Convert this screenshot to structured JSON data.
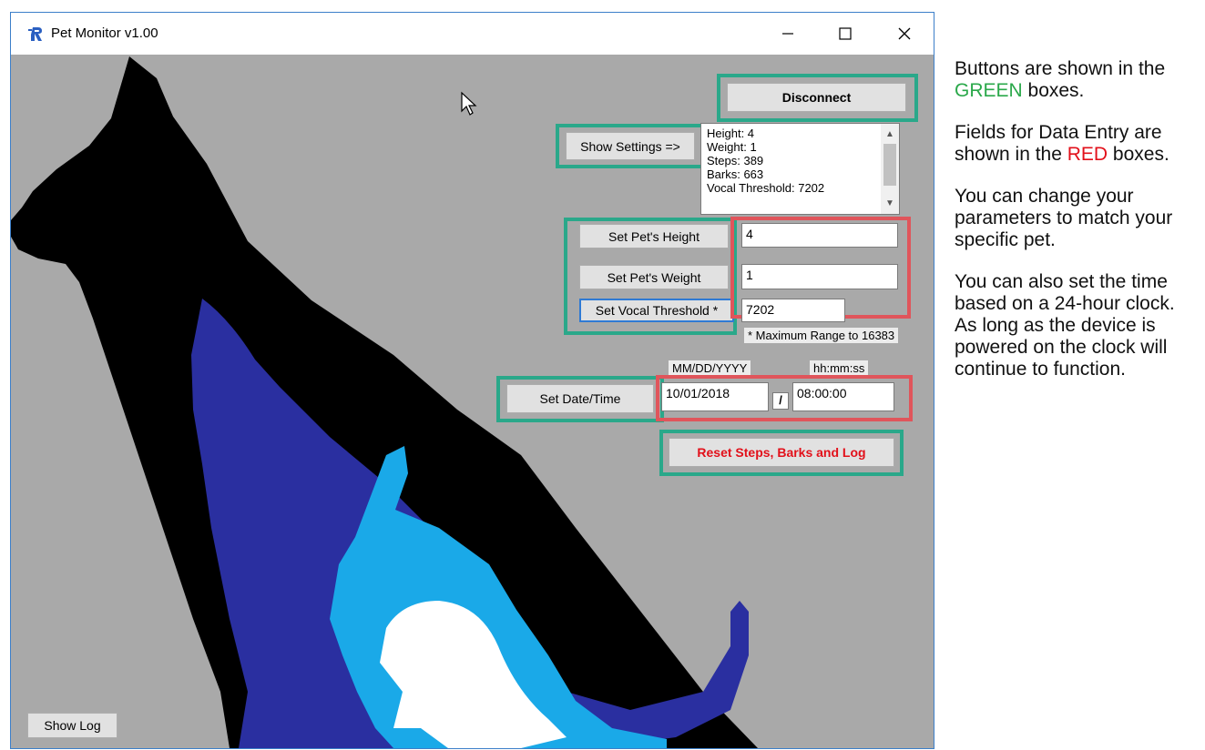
{
  "window": {
    "title": "Pet Monitor v1.00",
    "controls": {
      "minimize": "—",
      "maximize": "☐",
      "close": "✕"
    }
  },
  "buttons": {
    "disconnect": "Disconnect",
    "show_settings": "Show Settings =>",
    "set_height": "Set Pet's Height",
    "set_weight": "Set Pet's Weight",
    "set_vocal": "Set Vocal Threshold *",
    "set_datetime": "Set Date/Time",
    "reset": "Reset Steps, Barks and Log",
    "show_log": "Show Log"
  },
  "settings_list": [
    "Height: 4",
    "Weight: 1",
    "Steps: 389",
    "Barks: 663",
    "Vocal Threshold: 7202"
  ],
  "fields": {
    "height": "4",
    "weight": "1",
    "vocal": "7202",
    "date": "10/01/2018",
    "time": "08:00:00"
  },
  "labels": {
    "max_range": "* Maximum Range to 16383",
    "date_format": "MM/DD/YYYY",
    "time_format": "hh:mm:ss",
    "separator": "/"
  },
  "help": {
    "p1_a": "Buttons are shown in the ",
    "p1_green": "GREEN",
    "p1_b": " boxes.",
    "p2_a": "Fields for Data Entry are shown in the ",
    "p2_red": "RED",
    "p2_b": " boxes.",
    "p3": "You can change your parameters to match your specific pet.",
    "p4": "You can also set the time based on a 24-hour clock.  As long as the device is powered on the clock will continue to function."
  },
  "colors": {
    "button_highlight": "#2aa88a",
    "field_highlight": "#e0555b",
    "green_text": "#2aa84a",
    "red_text": "#e2101a",
    "background": "#a9a9a9"
  }
}
